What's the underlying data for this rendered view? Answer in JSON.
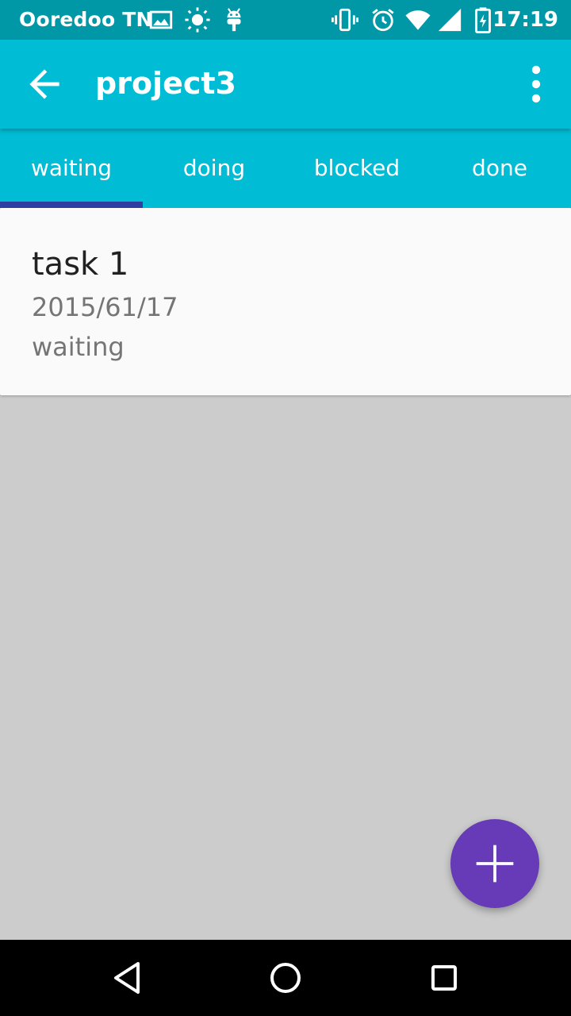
{
  "status_bar": {
    "carrier": "Ooredoo TN",
    "time": "17:19",
    "icons": [
      "image-icon",
      "brightness-icon",
      "android-icon",
      "vibrate-icon",
      "alarm-icon",
      "wifi-icon",
      "signal-icon",
      "battery-charging-icon"
    ]
  },
  "app_bar": {
    "title": "project3",
    "back_icon": "arrow-back-icon",
    "menu_icon": "more-vert-icon"
  },
  "tabs": [
    {
      "label": "waiting",
      "selected": true
    },
    {
      "label": "doing",
      "selected": false
    },
    {
      "label": "blocked",
      "selected": false
    },
    {
      "label": "done",
      "selected": false
    }
  ],
  "tasks": [
    {
      "title": "task 1",
      "date": "2015/61/17",
      "status": "waiting"
    }
  ],
  "fab": {
    "icon": "add-icon"
  },
  "nav_bar": {
    "icons": [
      "back-triangle-icon",
      "home-circle-icon",
      "recents-square-icon"
    ]
  },
  "colors": {
    "status_bar": "#0097a7",
    "primary": "#00bcd4",
    "tab_indicator": "#303f9f",
    "fab": "#673ab7",
    "background": "#cccccc",
    "card": "#fafafa"
  }
}
